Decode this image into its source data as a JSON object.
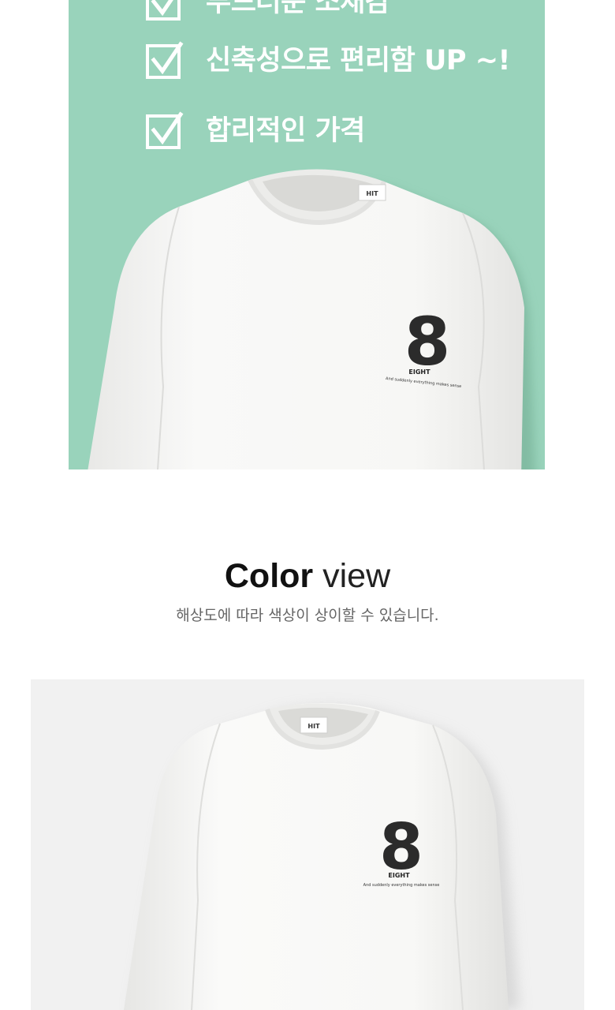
{
  "features": [
    {
      "label": "부드러운 소재감",
      "icon": "checkbox-checked-icon"
    },
    {
      "label": "신축성으로 편리함 UP ~!",
      "icon": "checkbox-checked-icon"
    },
    {
      "label": "합리적인 가격",
      "icon": "checkbox-checked-icon"
    }
  ],
  "product_print": {
    "number": "8",
    "word": "EIGHT",
    "tagline": "And suddenly everything makes sense",
    "neck_label": "HIT"
  },
  "color_view": {
    "title_bold": "Color",
    "title_light": " view",
    "notice": "해상도에 따라 색상이 상이할 수 있습니다."
  },
  "colors": {
    "mint_background": "#99d3bb",
    "photo_background": "#f1f1f1",
    "shirt": "#f7f7f5"
  }
}
